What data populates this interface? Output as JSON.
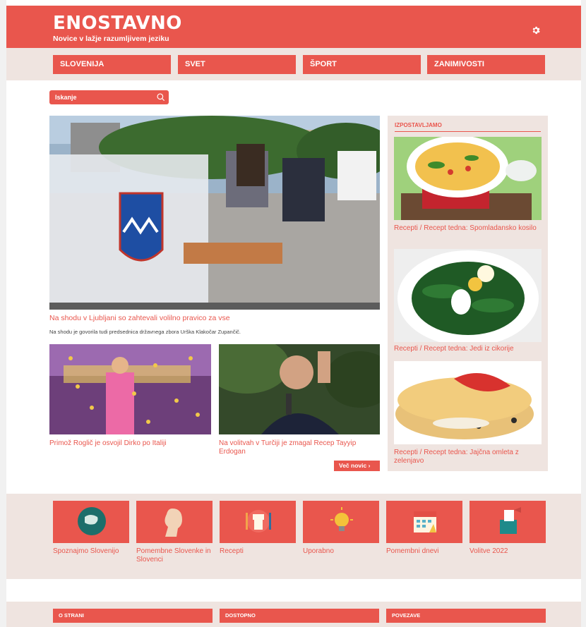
{
  "header": {
    "title": "ENOSTAVNO",
    "subtitle": "Novice v lažje razumljivem jeziku"
  },
  "nav": {
    "items": [
      "SLOVENIJA",
      "SVET",
      "ŠPORT",
      "ZANIMIVOSTI"
    ]
  },
  "search": {
    "placeholder": "Iskanje"
  },
  "main_article": {
    "title": "Na shodu v Ljubljani so zahtevali volilno pravico za vse",
    "description": "Na shodu je govorila tudi predsednica državnega zbora Urška Klakočar Zupančič."
  },
  "articles": [
    {
      "title": "Primož Roglič je osvojil Dirko po Italiji"
    },
    {
      "title": "Na volitvah v Turčiji je zmagal Recep Tayyip Erdogan"
    }
  ],
  "more_button": "Več novic ›",
  "sidebar": {
    "heading": "IZPOSTAVLJAMO",
    "items": [
      {
        "caption": "Recepti / Recept tedna: Spomladansko kosilo"
      },
      {
        "caption": "Recepti / Recept tedna: Jedi iz cikorije"
      },
      {
        "caption": "Recepti / Recept tedna: Jajčna omleta z zelenjavo"
      }
    ]
  },
  "categories": [
    {
      "label": "Spoznajmo Slovenijo",
      "icon": "globe-icon"
    },
    {
      "label": "Pomembne Slovenke in Slovenci",
      "icon": "portrait-icon"
    },
    {
      "label": "Recepti",
      "icon": "kitchen-icon"
    },
    {
      "label": "Uporabno",
      "icon": "lightbulb-icon"
    },
    {
      "label": "Pomembni dnevi",
      "icon": "calendar-icon"
    },
    {
      "label": "Volitve 2022",
      "icon": "ballot-box-icon"
    }
  ],
  "footer": {
    "items": [
      "O STRANI",
      "DOSTOPNO",
      "POVEZAVE"
    ]
  },
  "colors": {
    "accent": "#e9564d",
    "band": "#efe4e0"
  }
}
